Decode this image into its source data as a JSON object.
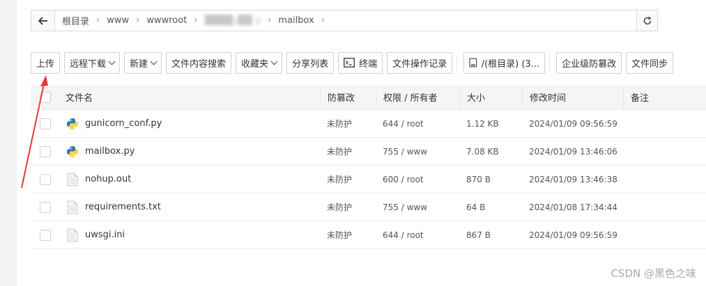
{
  "breadcrumb": {
    "items": [
      "根目录",
      "www",
      "wwwroot",
      "████g██.g",
      "mailbox"
    ]
  },
  "toolbar": {
    "upload": "上传",
    "remote_download": "远程下载",
    "new": "新建",
    "content_search": "文件内容搜索",
    "favorites": "收藏夹",
    "share_list": "分享列表",
    "terminal": "终端",
    "file_log": "文件操作记录",
    "disk": "/(根目录) (3...",
    "tamper_proof": "企业级防篡改",
    "file_sync": "文件同步"
  },
  "table": {
    "headers": {
      "name": "文件名",
      "protect": "防篡改",
      "perm": "权限 / 所有者",
      "size": "大小",
      "mtime": "修改时间",
      "note": "备注"
    },
    "rows": [
      {
        "name": "gunicorn_conf.py",
        "type": "python",
        "protect": "未防护",
        "perm": "644 / root",
        "size": "1.12 KB",
        "mtime": "2024/01/09 09:56:59"
      },
      {
        "name": "mailbox.py",
        "type": "python",
        "protect": "未防护",
        "perm": "755 / www",
        "size": "7.08 KB",
        "mtime": "2024/01/09 13:46:06"
      },
      {
        "name": "nohup.out",
        "type": "file",
        "protect": "未防护",
        "perm": "600 / root",
        "size": "870 B",
        "mtime": "2024/01/09 13:46:38"
      },
      {
        "name": "requirements.txt",
        "type": "file",
        "protect": "未防护",
        "perm": "755 / www",
        "size": "64 B",
        "mtime": "2024/01/08 17:34:44"
      },
      {
        "name": "uwsgi.ini",
        "type": "file",
        "protect": "未防护",
        "perm": "644 / root",
        "size": "867 B",
        "mtime": "2024/01/09 09:56:59"
      }
    ]
  },
  "watermark": "CSDN @黑色之味",
  "colors": {
    "arrow": "#e53935",
    "python_blue": "#3776ab",
    "python_yellow": "#ffd43b"
  }
}
